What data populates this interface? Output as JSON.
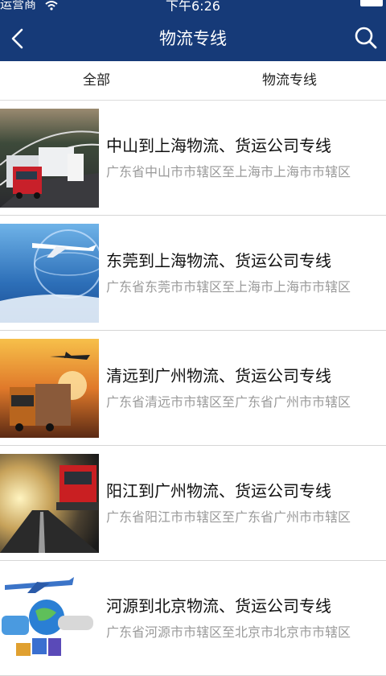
{
  "status_bar": {
    "carrier": "运营商",
    "time": "下午6:26"
  },
  "header": {
    "title": "物流专线",
    "back_icon": "chevron-left-icon",
    "search_icon": "search-icon"
  },
  "tabs": [
    {
      "label": "全部"
    },
    {
      "label": "物流专线"
    }
  ],
  "routes": [
    {
      "title": "中山到上海物流、货运公司专线",
      "route": "广东省中山市市辖区至上海市上海市市辖区"
    },
    {
      "title": "东莞到上海物流、货运公司专线",
      "route": "广东省东莞市市辖区至上海市上海市市辖区"
    },
    {
      "title": "清远到广州物流、货运公司专线",
      "route": "广东省清远市市辖区至广东省广州市市辖区"
    },
    {
      "title": "阳江到广州物流、货运公司专线",
      "route": "广东省阳江市市辖区至广东省广州市市辖区"
    },
    {
      "title": "河源到北京物流、货运公司专线",
      "route": "广东省河源市市辖区至北京市北京市市辖区"
    }
  ],
  "colors": {
    "header_bg": "#163a78",
    "title_text": "#111111",
    "route_text": "#9a9a9a"
  }
}
